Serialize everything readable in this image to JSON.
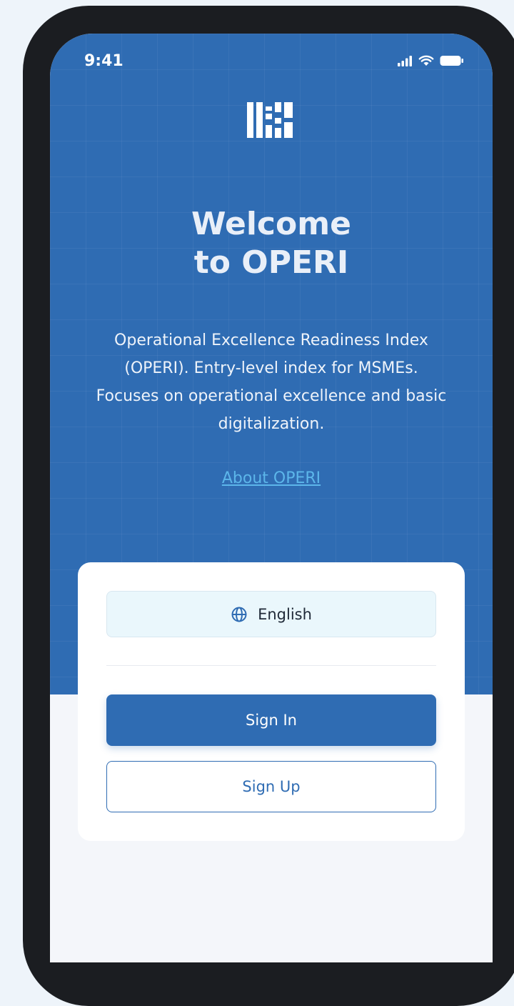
{
  "status_bar": {
    "time": "9:41",
    "icons": [
      "signal-icon",
      "wifi-icon",
      "battery-icon"
    ]
  },
  "hero": {
    "title_line1": "Welcome",
    "title_line2": "to OPERI",
    "description": "Operational Excellence Readiness Index (OPERI). Entry-level index for MSMEs. Focuses on operational excellence and basic digitalization.",
    "about_link": "About OPERI"
  },
  "card": {
    "language_label": "English",
    "language_icon": "globe-icon",
    "signin_label": "Sign In",
    "signup_label": "Sign Up"
  },
  "colors": {
    "primary": "#2f6cb3",
    "link": "#5cb6ea",
    "language_bg": "#eaf7fc"
  }
}
